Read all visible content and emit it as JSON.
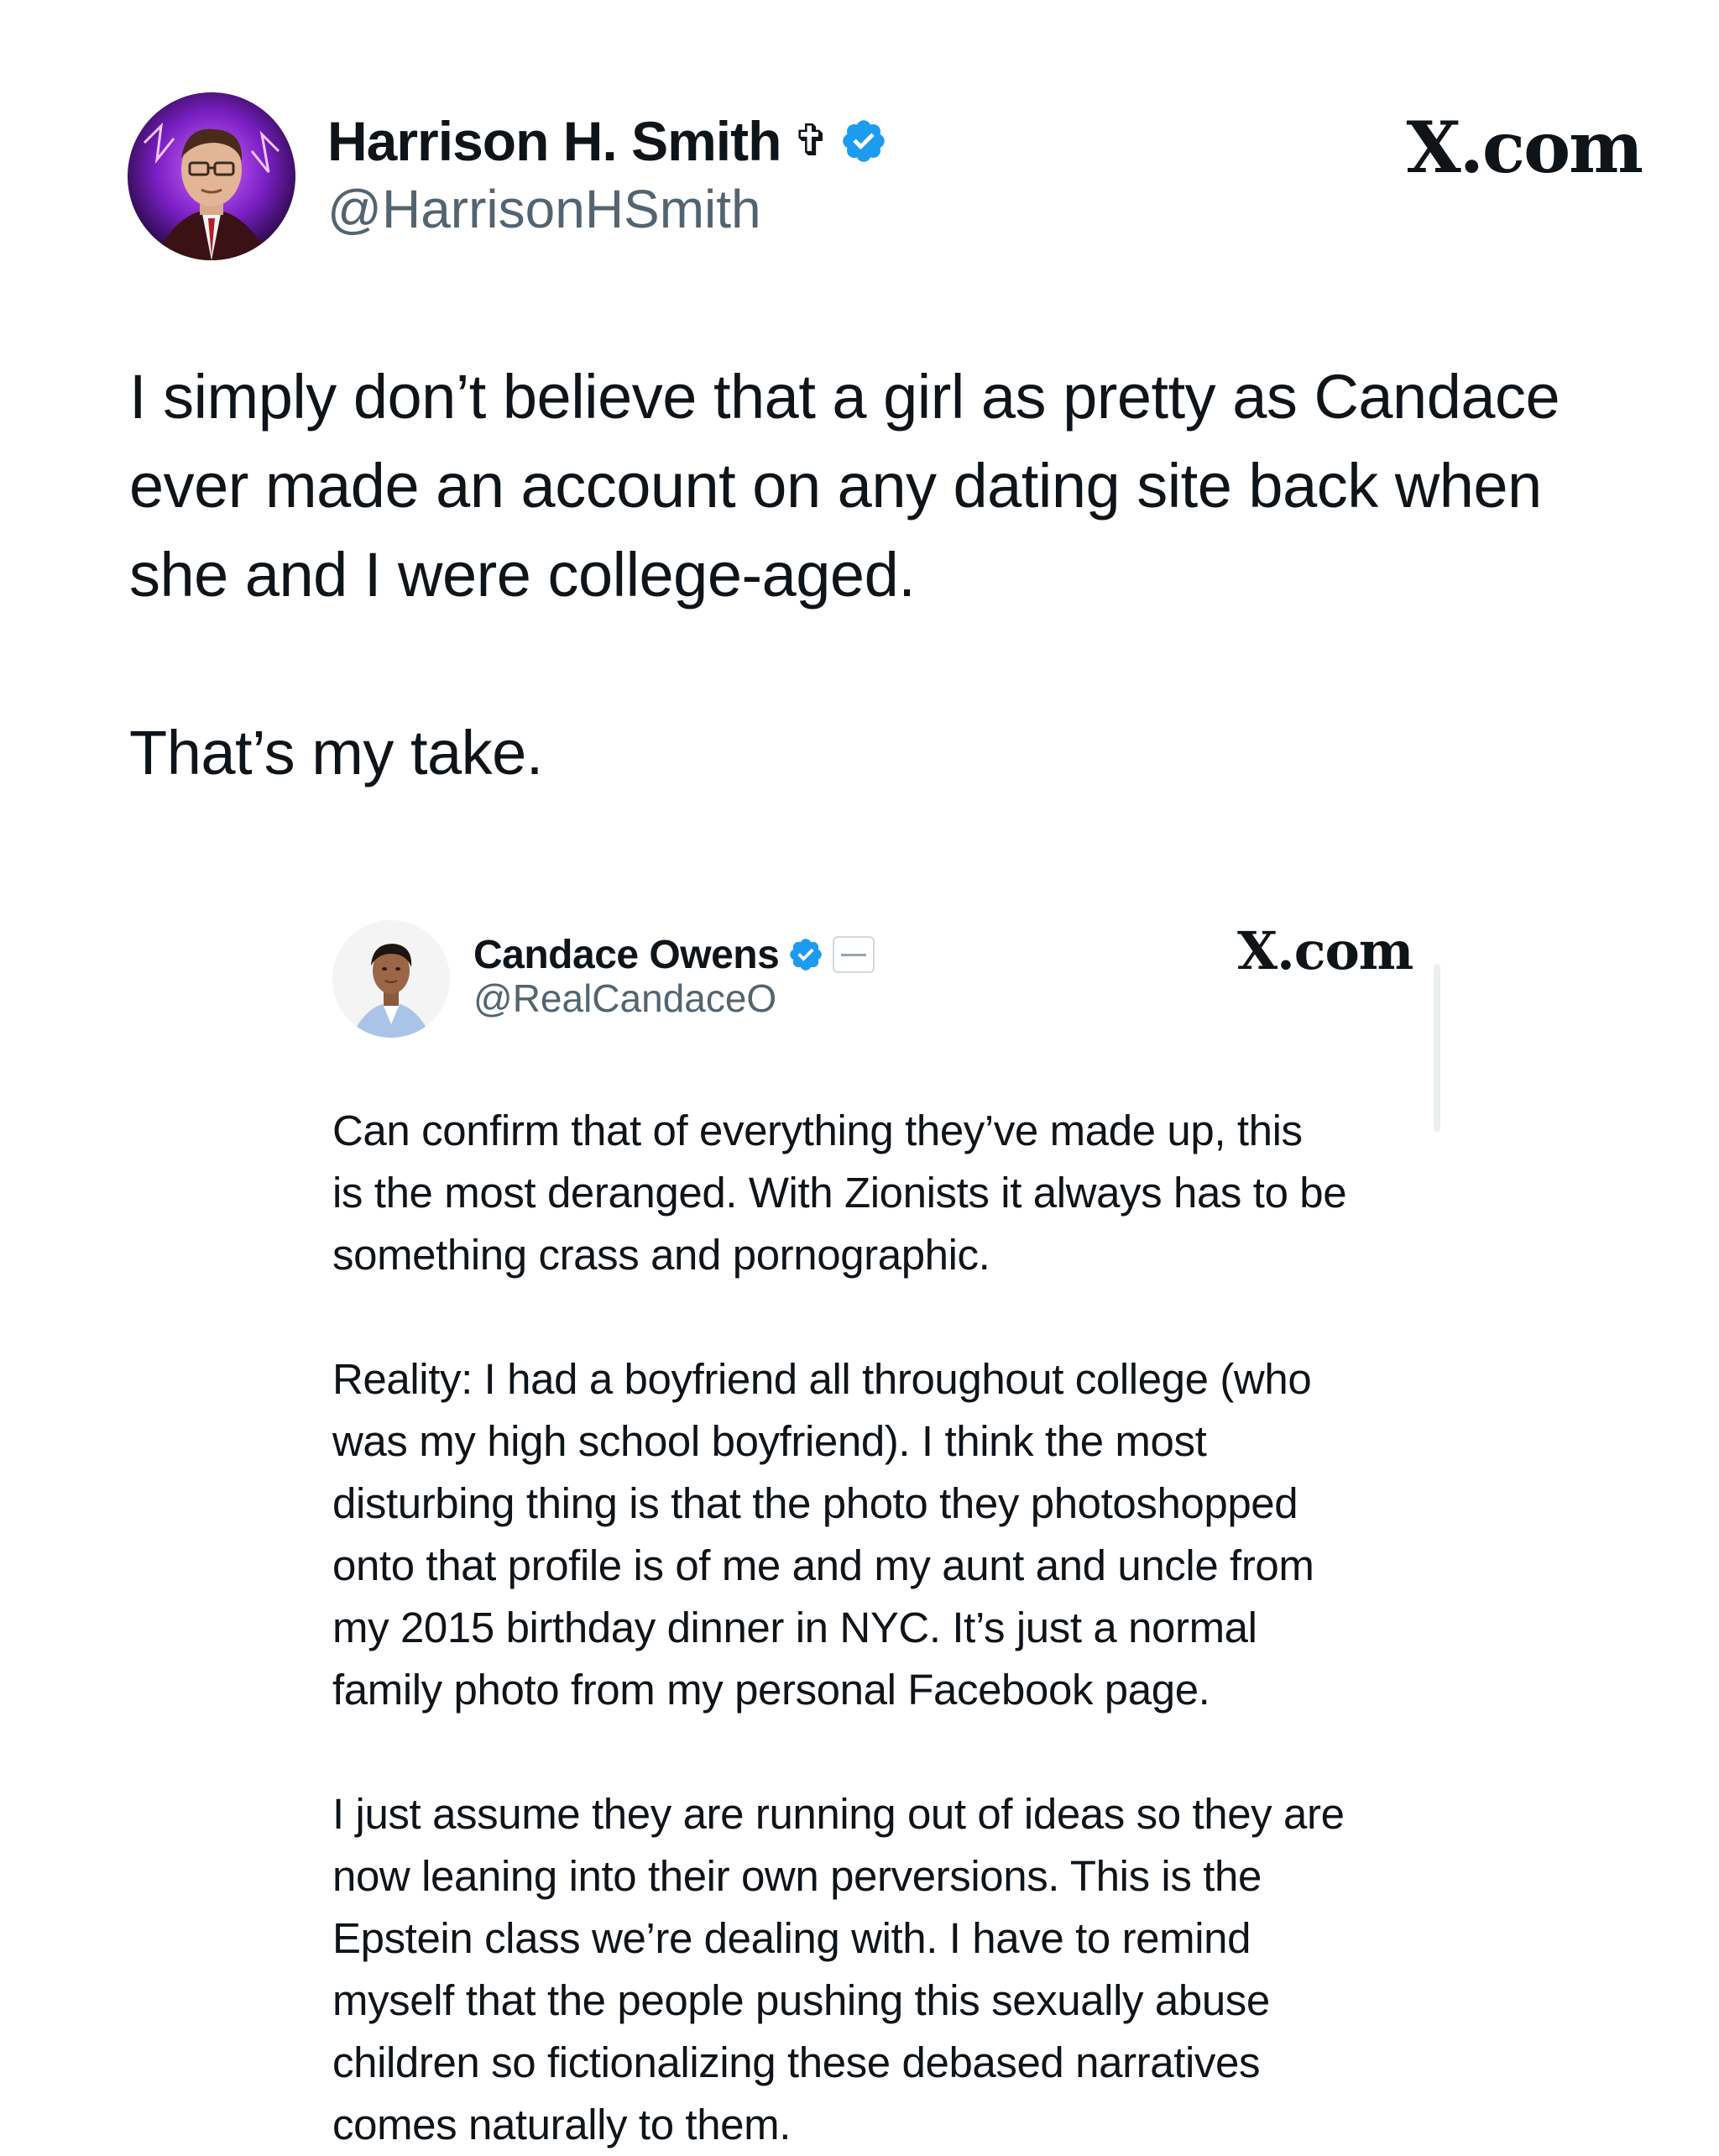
{
  "colors": {
    "verified_badge": "#1d9bf0",
    "handle_text": "#536471",
    "primary_text": "#0f1419"
  },
  "main_post": {
    "author": {
      "name": "Harrison H. Smith",
      "name_emoji": "✞",
      "handle": "@HarrisonHSmith",
      "verified": true,
      "avatar_icon": "avatar-photo"
    },
    "brand": "X.com",
    "paragraphs": [
      {
        "lines": [
          "I simply don’t believe that a girl as pretty as Candace",
          "ever made an account on any dating site back when",
          "she and I were college-aged."
        ]
      },
      {
        "lines": [
          "That’s my take."
        ]
      }
    ]
  },
  "quoted_post": {
    "author": {
      "name": "Candace Owens",
      "handle": "@RealCandaceO",
      "verified": true,
      "affiliation_icon": "affiliation-badge-icon",
      "avatar_icon": "avatar-photo"
    },
    "brand": "X.com",
    "paragraphs": [
      {
        "lines": [
          "Can confirm that of everything they’ve made up, this",
          "is the most deranged. With Zionists it always has to be",
          "something crass and pornographic."
        ]
      },
      {
        "lines": [
          "Reality: I had a boyfriend all throughout college (who",
          "was my high school boyfriend). I think the most",
          "disturbing thing is that the photo they photoshopped",
          "onto that profile is of me and my aunt and uncle from",
          "my 2015 birthday dinner in NYC. It’s just a normal",
          "family photo from my personal Facebook page."
        ]
      },
      {
        "lines": [
          "I just assume they are running out of ideas so they are",
          "now leaning into their own perversions. This is the",
          "Epstein class we’re dealing with. I have to remind",
          "myself that the people pushing this sexually abuse",
          "children so fictionalizing these debased narratives",
          "comes naturally to them."
        ]
      }
    ]
  }
}
